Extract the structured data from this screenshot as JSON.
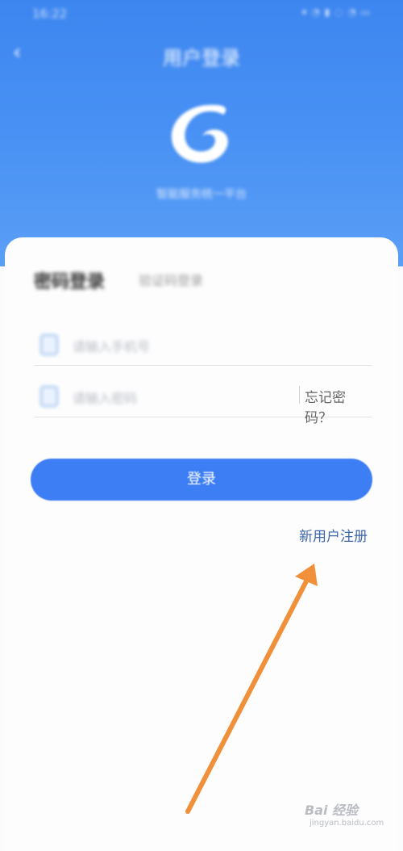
{
  "status_bar": {
    "time": "16:22",
    "indicators": "▾ ◔ ▮ ◌ ◔ ▭"
  },
  "header": {
    "back_icon": "chevron-left-icon",
    "title": "用户登录",
    "logo_caption": "智能服务统一平台"
  },
  "tabs": [
    {
      "label": "密码登录",
      "active": true
    },
    {
      "label": "验证码登录",
      "active": false
    }
  ],
  "form": {
    "account": {
      "icon": "phone-icon",
      "placeholder": "请输入手机号"
    },
    "password": {
      "icon": "lock-icon",
      "placeholder": "请输入密码",
      "forgot_label": "忘记密码？"
    }
  },
  "actions": {
    "login_label": "登录",
    "register_label": "新用户注册"
  },
  "colors": {
    "header_blue": "#4a92f4",
    "button_blue": "#3d7ef5",
    "arrow_orange": "#f1903a",
    "link_blue": "#3d67a8"
  },
  "watermark": {
    "brand": "Bai 经验",
    "url": "jingyan.baidu.com"
  }
}
